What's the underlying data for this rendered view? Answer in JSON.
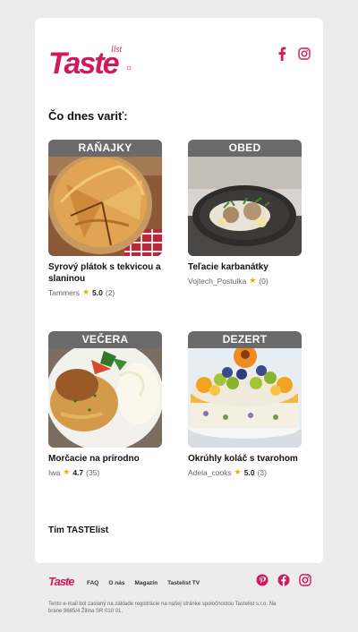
{
  "brand": {
    "logo_main": "Taste",
    "logo_sub": "list",
    "color": "#d2185e"
  },
  "heading": "Čo dnes variť:",
  "recipes": [
    {
      "category": "RAŇAJKY",
      "title": "Syrový plátok s tekvicou a slaninou",
      "author": "Tammers",
      "rating": "5.0",
      "count": "(2)"
    },
    {
      "category": "OBED",
      "title": "Teľacie karbanátky",
      "author": "Vojtech_Postulka",
      "rating": "",
      "count": "(0)"
    },
    {
      "category": "VEČERA",
      "title": "Morčacie na prírodno",
      "author": "Iwa",
      "rating": "4.7",
      "count": "(35)"
    },
    {
      "category": "DEZERT",
      "title": "Okrúhly koláč s tvarohom",
      "author": "Adela_cooks",
      "rating": "5.0",
      "count": "(3)"
    }
  ],
  "signature": "Tím TASTElist",
  "footer": {
    "links": [
      "FAQ",
      "O nás",
      "Magazín",
      "Tastelist TV"
    ],
    "note": "Tento e-mail bol zaslaný na základe registrácie na našej stránke spoločnostou Tastelist s.r.o. Na bráne 8665/4 Žilina SR 010 01."
  },
  "icons": {
    "top": [
      "facebook-icon",
      "instagram-icon"
    ],
    "footer": [
      "pinterest-icon",
      "facebook-icon",
      "instagram-icon"
    ],
    "star": "star-icon"
  }
}
